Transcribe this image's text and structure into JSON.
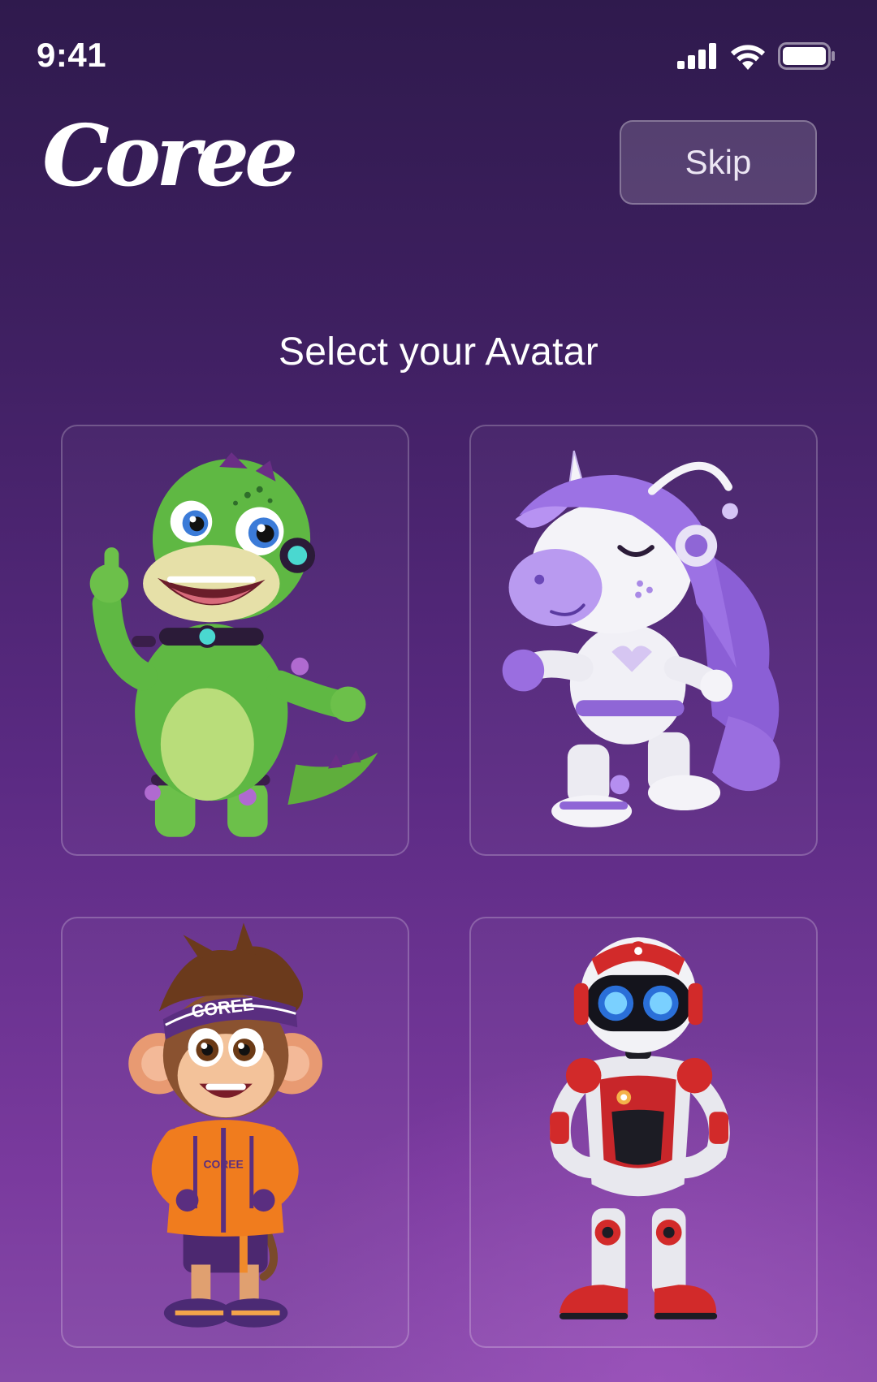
{
  "status_bar": {
    "time": "9:41",
    "icons": [
      "cellular-signal-icon",
      "wifi-icon",
      "battery-icon"
    ]
  },
  "header": {
    "logo_text": "Coree",
    "skip_label": "Skip"
  },
  "title": "Select your Avatar",
  "avatars": [
    {
      "name": "dinosaur-avatar",
      "headband_text": ""
    },
    {
      "name": "unicorn-avatar",
      "headband_text": ""
    },
    {
      "name": "monkey-avatar",
      "headband_text": "COREE",
      "jacket_text": "COREE"
    },
    {
      "name": "robot-avatar",
      "headband_text": ""
    }
  ],
  "colors": {
    "background_top": "#2f1a4d",
    "background_bottom": "#864aa8",
    "text": "#ffffff",
    "card_border": "rgba(255,255,255,0.22)"
  }
}
